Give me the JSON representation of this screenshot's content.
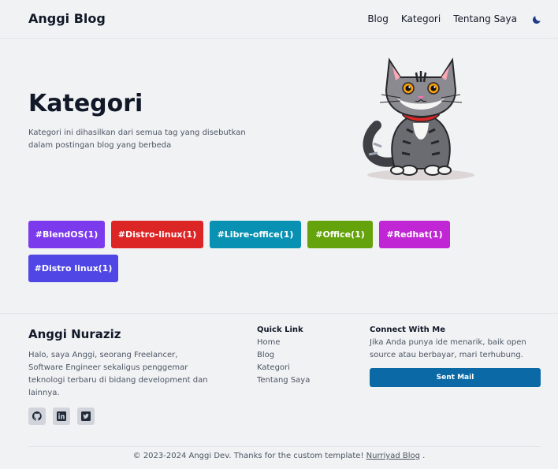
{
  "header": {
    "brand": "Anggi Blog",
    "nav": [
      "Blog",
      "Kategori",
      "Tentang Saya"
    ],
    "theme_icon": "moon-icon"
  },
  "hero": {
    "title": "Kategori",
    "description": "Kategori ini dihasilkan dari semua tag yang disebutkan dalam postingan blog yang berbeda",
    "image": "cat-illustration"
  },
  "tags": [
    {
      "label": "#BlendOS(1)",
      "color": "#7c3aed"
    },
    {
      "label": "#Distro-linux(1)",
      "color": "#dc2626"
    },
    {
      "label": "#Libre-office(1)",
      "color": "#0891b2"
    },
    {
      "label": "#Office(1)",
      "color": "#65a30d"
    },
    {
      "label": "#Redhat(1)",
      "color": "#c026d3"
    },
    {
      "label": "#Distro linux(1)",
      "color": "#4f46e5"
    }
  ],
  "footer": {
    "name": "Anggi Nuraziz",
    "bio": "Halo, saya Anggi, seorang Freelancer, Software Engineer sekaligus penggemar teknologi terbaru di bidang development dan lainnya.",
    "socials": [
      "github-icon",
      "linkedin-icon",
      "twitter-icon"
    ],
    "quick_link_title": "Quick Link",
    "quick_links": [
      "Home",
      "Blog",
      "Kategori",
      "Tentang Saya"
    ],
    "connect_title": "Connect With Me",
    "connect_desc": "Jika Anda punya ide menarik, baik open source atau berbayar, mari terhubung.",
    "mail_button": "Sent Mail",
    "copyright_prefix": "© 2023-2024 Anggi Dev. Thanks for the custom template!",
    "copyright_link": "Nurriyad Blog",
    "copyright_suffix": "."
  }
}
